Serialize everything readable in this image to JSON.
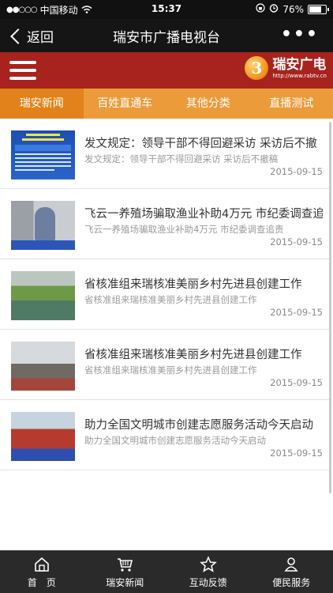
{
  "status_bar": {
    "carrier": "中国移动",
    "time": "15:37",
    "battery_percent": "76%",
    "battery_level": 0.76
  },
  "nav": {
    "back_label": "返回",
    "title": "瑞安市广播电视台",
    "more_label": "•••"
  },
  "brand": {
    "logo_letter": "3",
    "logo_text": "瑞安广电",
    "logo_url": "http://www.rabtv.cn"
  },
  "tabs": [
    {
      "label": "瑞安新闻",
      "active": true
    },
    {
      "label": "百姓直通车",
      "active": false
    },
    {
      "label": "其他分类",
      "active": false
    },
    {
      "label": "直播测试",
      "active": false
    }
  ],
  "news": [
    {
      "title": "发文规定：领导干部不得回避采访 采访后不撤",
      "desc": "发文规定：领导干部不得回避采访 采访后不撤稿",
      "date": "2015-09-15",
      "thumb": "doc"
    },
    {
      "title": "飞云一养殖场骗取渔业补助4万元 市纪委调查追",
      "desc": "飞云一养殖场骗取渔业补助4万元 市纪委调查追责",
      "date": "2015-09-15",
      "thumb": "photo1"
    },
    {
      "title": "省核准组来瑞核准美丽乡村先进县创建工作",
      "desc": "省核准组来瑞核准美丽乡村先进县创建工作",
      "date": "2015-09-15",
      "thumb": "photo2"
    },
    {
      "title": "省核准组来瑞核准美丽乡村先进县创建工作",
      "desc": "省核准组来瑞核准美丽乡村先进县创建工作",
      "date": "2015-09-15",
      "thumb": "photo3"
    },
    {
      "title": "助力全国文明城市创建志愿服务活动今天启动",
      "desc": "助力全国文明城市创建志愿服务活动今天启动",
      "date": "2015-09-15",
      "thumb": "photo4"
    }
  ],
  "bottom_nav": [
    {
      "label": "首　页",
      "icon": "home-icon"
    },
    {
      "label": "瑞安新闻",
      "icon": "cart-icon"
    },
    {
      "label": "互动反馈",
      "icon": "star-icon"
    },
    {
      "label": "便民服务",
      "icon": "person-icon"
    }
  ],
  "colors": {
    "brand_red": "#a8231e",
    "tab_orange": "#ec9b3b",
    "tab_active": "#e2821a",
    "bottom_bar": "#2a2a2a"
  }
}
